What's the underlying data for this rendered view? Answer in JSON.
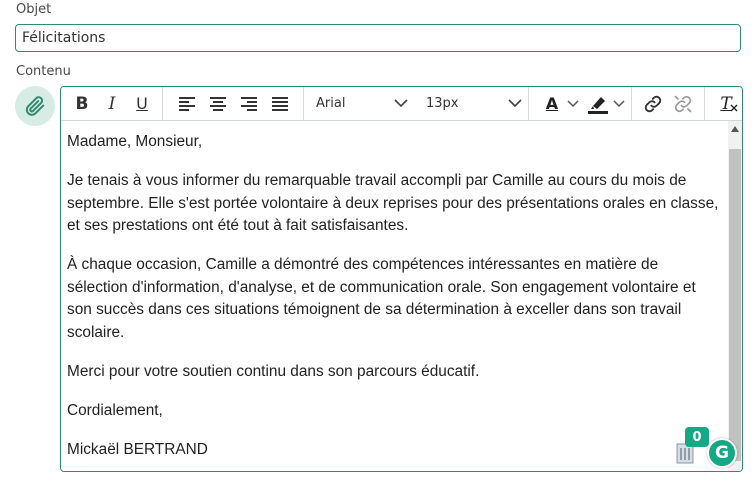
{
  "subject": {
    "label": "Objet",
    "value": "Félicitations"
  },
  "content": {
    "label": "Contenu",
    "paragraphs": [
      "Madame, Monsieur,",
      "Je tenais à vous informer du remarquable travail accompli par Camille au cours du mois de septembre. Elle s'est portée volontaire à deux reprises pour des présentations orales en classe, et ses prestations ont été tout à fait satisfaisantes.",
      "À chaque occasion, Camille a démontré des compétences intéressantes en matière de sélection d'information, d'analyse, et de communication orale. Son engagement volontaire et son succès dans ces situations témoignent de sa détermination à exceller dans son travail scolaire.",
      "Merci pour votre soutien continu dans son parcours éducatif.",
      "Cordialement,",
      "Mickaël BERTRAND"
    ]
  },
  "toolbar": {
    "bold": "B",
    "italic": "I",
    "underline": "U",
    "font_family": "Arial",
    "font_size": "13px",
    "text_color": "A",
    "clear_format": "T"
  },
  "widgets": {
    "badge_count": "0",
    "grammarly_letter": "G"
  },
  "colors": {
    "accent": "#2e8b6e",
    "grammarly": "#15a884"
  }
}
